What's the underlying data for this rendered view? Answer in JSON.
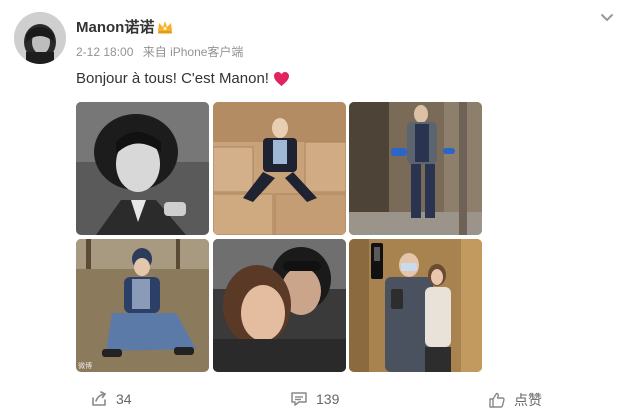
{
  "post": {
    "author": "Manon诺诺",
    "date": "2-12 18:00",
    "source": "来自 iPhone客户端",
    "text": "Bonjour à tous! C'est Manon!",
    "images": [
      {
        "desc": "bw-portrait",
        "watermark": ""
      },
      {
        "desc": "man-on-boxes",
        "watermark": ""
      },
      {
        "desc": "street-style",
        "watermark": ""
      },
      {
        "desc": "woman-sitting-grass",
        "watermark": "微博"
      },
      {
        "desc": "couple-selfie",
        "watermark": ""
      },
      {
        "desc": "elevator-selfie",
        "watermark": ""
      }
    ],
    "actions": {
      "repost_count": "34",
      "comment_count": "139",
      "like_label": "点赞"
    }
  },
  "icons": {
    "crown": "crown-icon",
    "heart": "heart-icon",
    "chevron": "chevron-down-icon",
    "repost": "share-icon",
    "comment": "comment-icon",
    "like": "thumbs-up-icon"
  },
  "colors": {
    "heart": "#e0245e",
    "crown": "#f6b02e",
    "meta": "#939393"
  }
}
